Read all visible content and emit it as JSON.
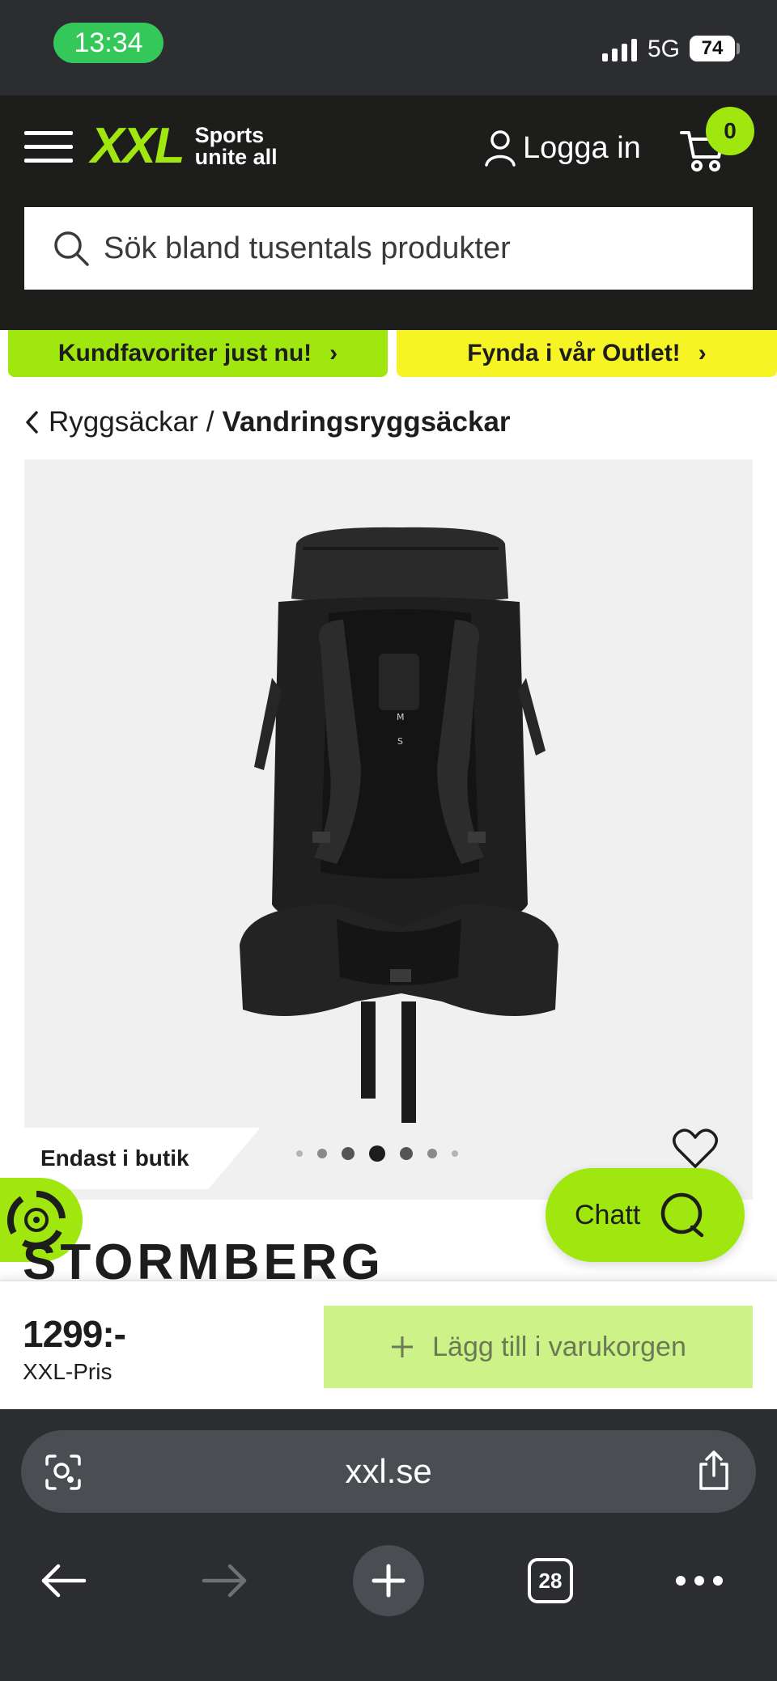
{
  "status_bar": {
    "time": "13:34",
    "network": "5G",
    "battery": "74"
  },
  "header": {
    "logo": {
      "brand": "XXL",
      "tagline_1": "Sports",
      "tagline_2": "unite all"
    },
    "login_label": "Logga in",
    "cart_count": "0",
    "search": {
      "placeholder": "Sök bland tusentals produkter"
    }
  },
  "promos": [
    {
      "label": "Kundfavoriter just nu!",
      "arrow": "›",
      "color": "#9fe70f"
    },
    {
      "label": "Fynda i vår Outlet!",
      "arrow": "›",
      "color": "#f7f425"
    }
  ],
  "breadcrumb": {
    "parent": "Ryggsäckar",
    "separator": "/",
    "current": "Vandringsryggsäckar"
  },
  "product": {
    "image_icon": "backpack-image",
    "gallery": {
      "slide_count": 7,
      "active_index": 3
    },
    "availability_badge": "Endast i butik",
    "brand": "STORMBERG",
    "price": "1299:-",
    "price_label": "XXL-Pris",
    "add_to_cart_label": "Lägg till i varukorgen"
  },
  "chat": {
    "label": "Chatt"
  },
  "browser": {
    "url": "xxl.se",
    "tab_count": "28"
  },
  "colors": {
    "accent_green": "#9fe70f",
    "outlet_yellow": "#f7f425",
    "header_bg": "#1d1d1b",
    "add_to_cart_bg": "#cdf287"
  }
}
